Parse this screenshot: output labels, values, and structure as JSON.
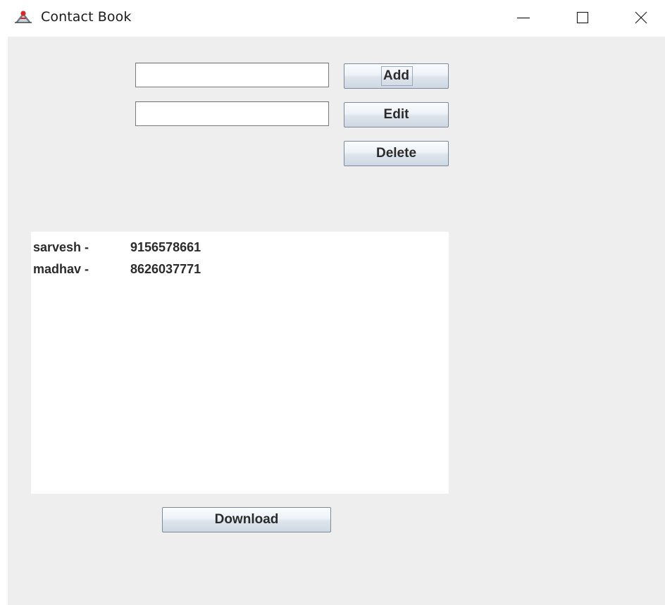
{
  "window": {
    "title": "Contact Book",
    "icon": "java-cup-icon",
    "controls": [
      "minimize-icon",
      "maximize-icon",
      "close-icon"
    ]
  },
  "form": {
    "name_input": {
      "value": "",
      "placeholder": ""
    },
    "phone_input": {
      "value": "",
      "placeholder": ""
    },
    "add_label": "Add",
    "edit_label": "Edit",
    "delete_label": "Delete"
  },
  "contacts": [
    {
      "name": "sarvesh -",
      "number": "9156578661"
    },
    {
      "name": "madhav -",
      "number": "8626037771"
    }
  ],
  "footer": {
    "download_label": "Download"
  },
  "colors": {
    "panel_background": "#eeeeee",
    "button_border": "#7a8a9c",
    "text": "#2b2b2b"
  }
}
